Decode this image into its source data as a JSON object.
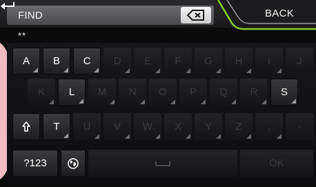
{
  "search": {
    "label": "FIND",
    "entered": "**"
  },
  "back": {
    "label": "BACK"
  },
  "keyboard": {
    "row1": [
      {
        "label": "A",
        "enabled": true
      },
      {
        "label": "B",
        "enabled": true
      },
      {
        "label": "C",
        "enabled": true
      },
      {
        "label": "D",
        "enabled": false
      },
      {
        "label": "E",
        "enabled": false
      },
      {
        "label": "F",
        "enabled": false
      },
      {
        "label": "G",
        "enabled": false
      },
      {
        "label": "H",
        "enabled": false
      },
      {
        "label": "I",
        "enabled": false
      },
      {
        "label": "J",
        "enabled": false
      }
    ],
    "row2": [
      {
        "label": "K",
        "enabled": false
      },
      {
        "label": "L",
        "enabled": true
      },
      {
        "label": "M",
        "enabled": false
      },
      {
        "label": "N",
        "enabled": false
      },
      {
        "label": "O",
        "enabled": false
      },
      {
        "label": "P",
        "enabled": false
      },
      {
        "label": "Q",
        "enabled": false
      },
      {
        "label": "R",
        "enabled": false
      },
      {
        "label": "S",
        "enabled": true
      }
    ],
    "row3": [
      {
        "label": "T",
        "enabled": true
      },
      {
        "label": "U",
        "enabled": false
      },
      {
        "label": "V",
        "enabled": false
      },
      {
        "label": "W",
        "enabled": false
      },
      {
        "label": "X",
        "enabled": false
      },
      {
        "label": "Y",
        "enabled": false
      },
      {
        "label": "Z",
        "enabled": false
      },
      {
        "label": ",",
        "enabled": false
      },
      {
        "label": "-",
        "enabled": false
      }
    ],
    "shift_icon": "shift-arrow-icon",
    "numeric_label": "?123",
    "language_icon": "globe-icon",
    "space_icon": "space-bar-icon",
    "ok_label": "OK"
  },
  "colors": {
    "accent": "#8ccf2a",
    "enabled_key_text": "#ffffff",
    "disabled_key_text": "#3c3c3f"
  }
}
